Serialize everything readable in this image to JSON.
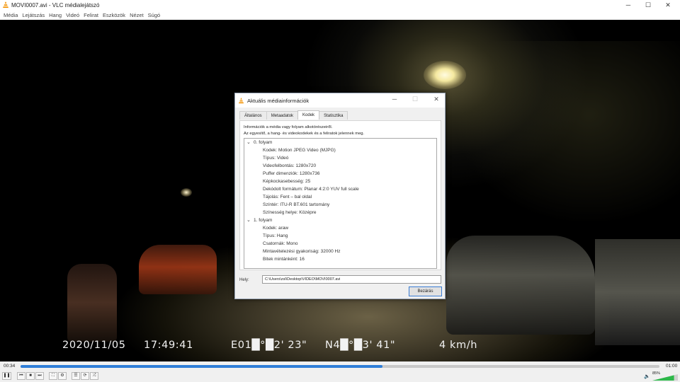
{
  "app": {
    "title": "MOVI0007.avi - VLC médialejátszó",
    "window_controls": {
      "minimize": "─",
      "maximize": "☐",
      "close": "✕"
    }
  },
  "menu": [
    "Média",
    "Lejátszás",
    "Hang",
    "Videó",
    "Felirat",
    "Eszközök",
    "Nézet",
    "Súgó"
  ],
  "osd": {
    "date": "2020/11/05",
    "time": "17:49:41",
    "lon": "E01█°█2' 23\"",
    "lat": "N4█°█3' 41\"",
    "speed": "4 km/h"
  },
  "dialog": {
    "title": "Aktuális médiainformációk",
    "controls": {
      "minimize": "─",
      "maximize": "☐",
      "close": "✕"
    },
    "tabs": [
      "Általános",
      "Metaadatok",
      "Kodek",
      "Statisztika"
    ],
    "active_tab": 2,
    "intro_line1": "Információk a média vagy folyam alkotórészeiről.",
    "intro_line2": "Az egyesítő, a hang- és videokodekek és a feliratok jelennek meg.",
    "streams": [
      {
        "label": "0. folyam",
        "items": [
          "Kodek: Motion JPEG Video (MJPG)",
          "Típus: Videó",
          "Videofelbontás: 1280x720",
          "Puffer dimenziók: 1280x736",
          "Képkockasebesség: 25",
          "Dekódolt formátum: Planar 4:2:0 YUV full scale",
          "Tájolás: Fent – bal oldal",
          "Színtér: ITU-R BT.601 tartomány",
          "Színesség helye: Középre"
        ]
      },
      {
        "label": "1. folyam",
        "items": [
          "Kodek: araw",
          "Típus: Hang",
          "Csatornák: Mono",
          "Mintavételezési gyakoriság: 32000 Hz",
          "Bitek mintánként: 16"
        ]
      }
    ],
    "location_label": "Hely:",
    "location_value": "C:\\Users\\zsl\\Desktop\\VIDEO\\MOVI0007.avi",
    "close_button": "Bezárás"
  },
  "player": {
    "elapsed": "00:34",
    "total": "01:00",
    "progress": 0.5667,
    "volume": "85%",
    "volume_level": 0.85,
    "buttons": {
      "pause": "❚❚",
      "prev": "⏮",
      "stop": "■",
      "next": "⏭",
      "fullscreen": "⛶",
      "extended": "⚙",
      "playlist": "☰",
      "loop": "⟳",
      "random": "⤮"
    },
    "accent": "#2f7ed8"
  }
}
